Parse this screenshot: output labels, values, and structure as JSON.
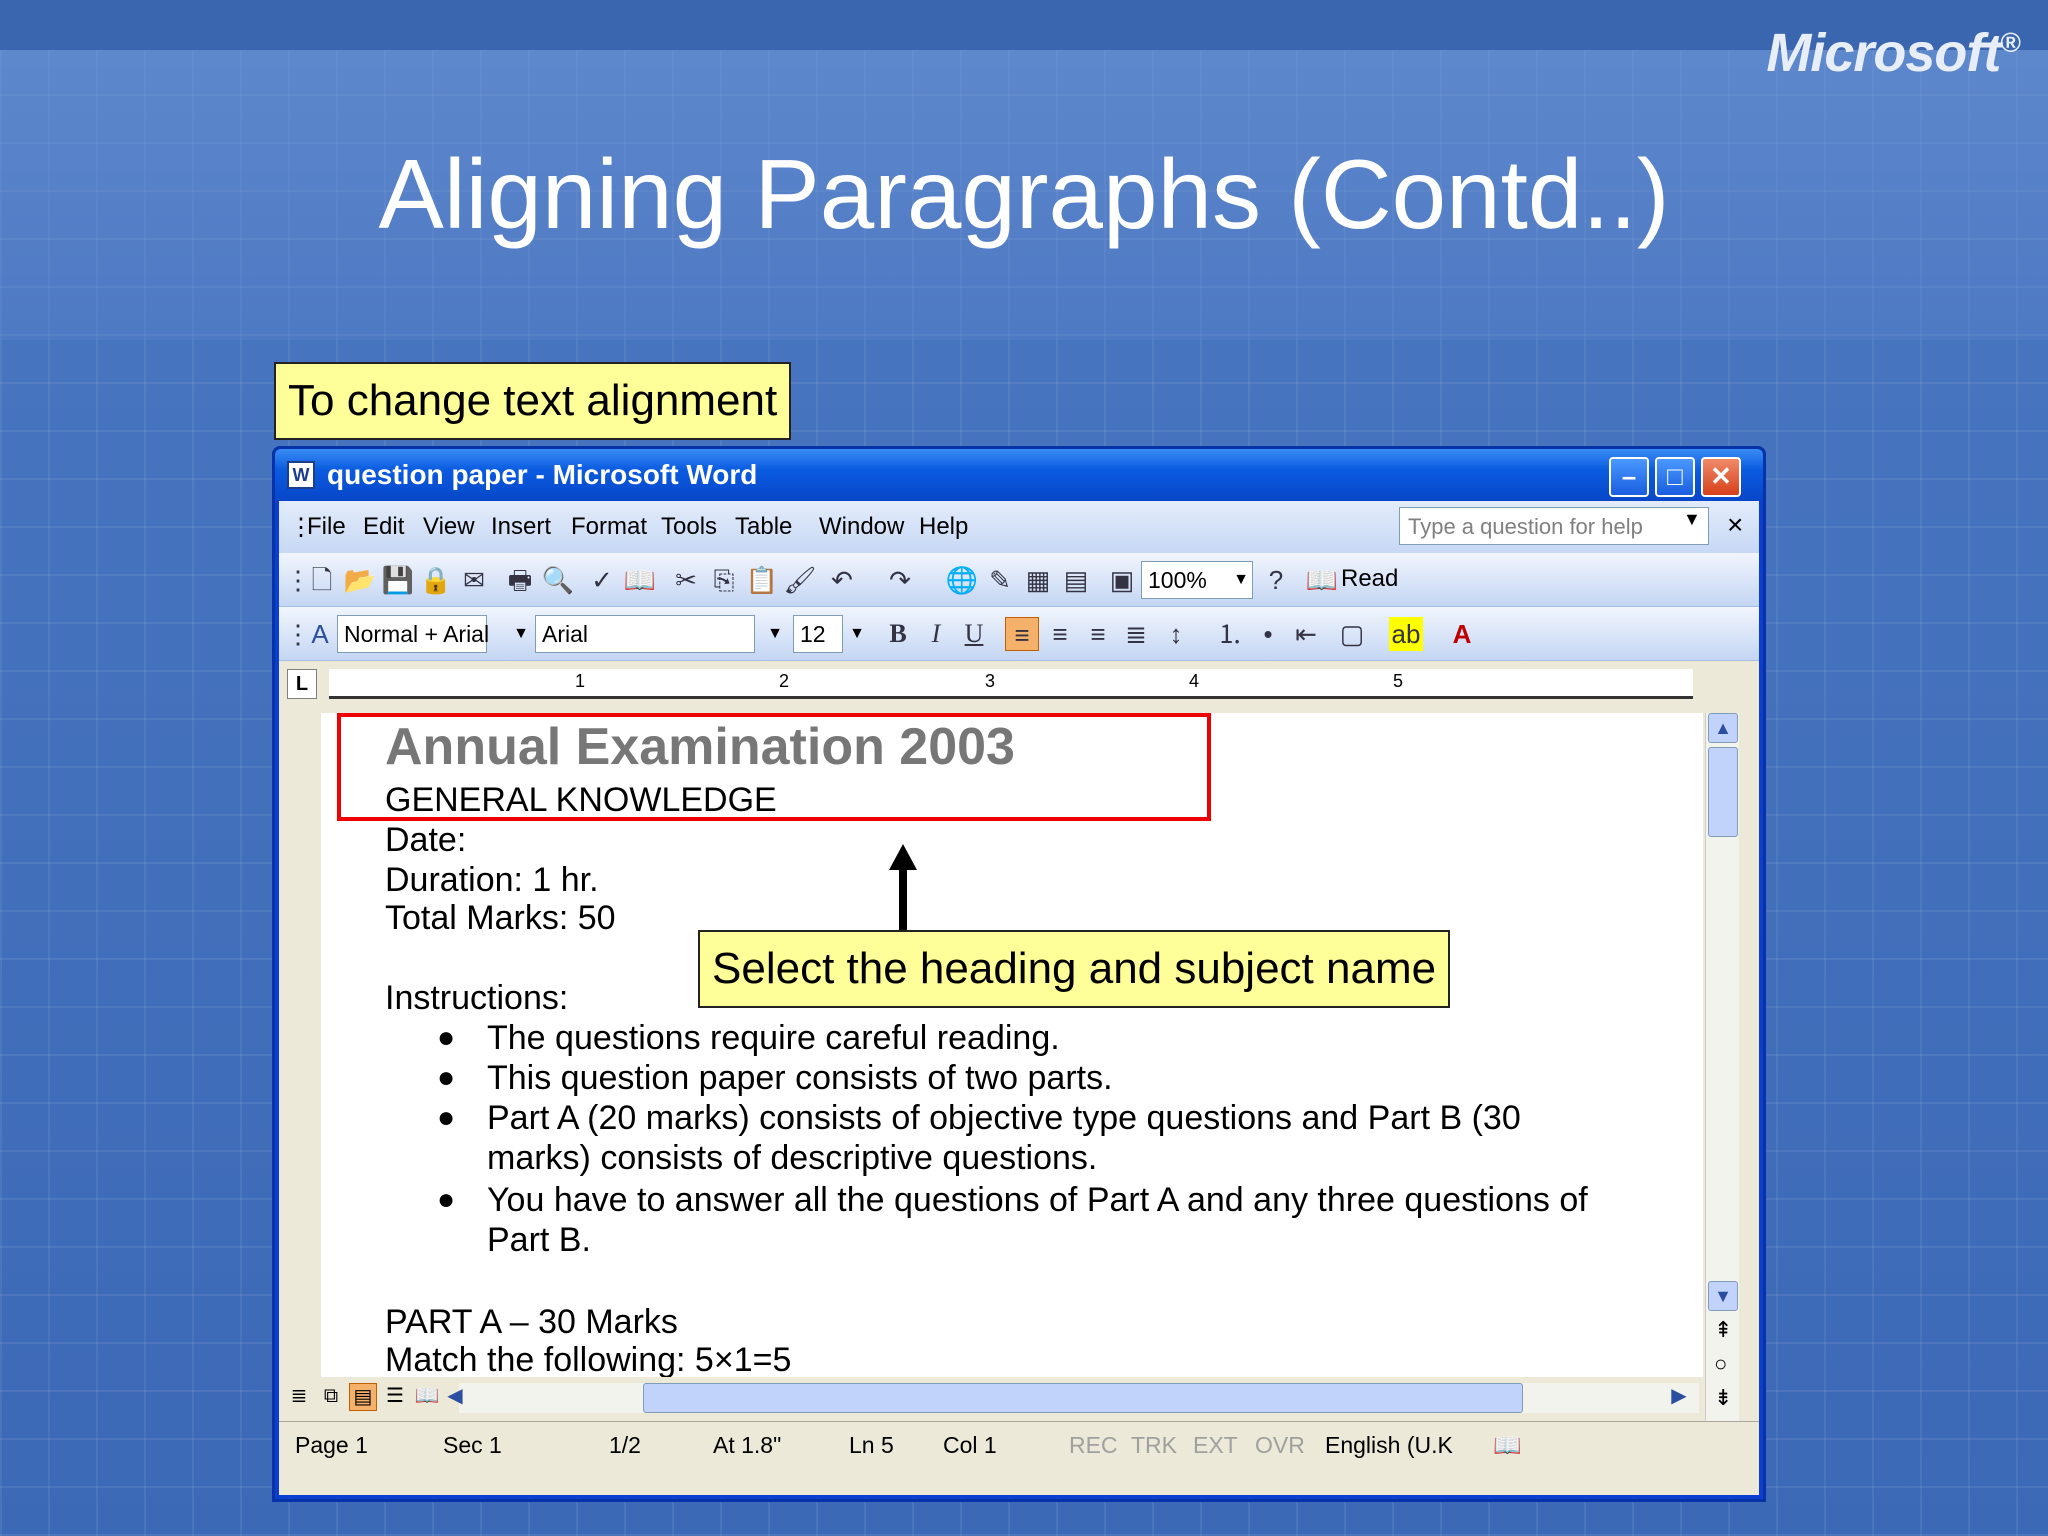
{
  "slide": {
    "brand": "Microsoft",
    "brand_mark": "®",
    "title": "Aligning Paragraphs (Contd..)",
    "callout_top": "To change text alignment",
    "callout_doc": "Select the heading and subject name"
  },
  "window": {
    "title": "question paper - Microsoft Word",
    "icon": "W"
  },
  "menu": {
    "items": [
      "File",
      "Edit",
      "View",
      "Insert",
      "Format",
      "Tools",
      "Table",
      "Window",
      "Help"
    ],
    "help_placeholder": "Type a question for help"
  },
  "standard_toolbar": {
    "zoom": "100%",
    "read_label": "Read"
  },
  "formatting_toolbar": {
    "style": "Normal + Arial",
    "font": "Arial",
    "size": "12",
    "bold": "B",
    "italic": "I",
    "underline": "U"
  },
  "ruler": {
    "numbers": [
      "1",
      "2",
      "3",
      "4",
      "5"
    ],
    "tab_selector": "L"
  },
  "document": {
    "heading": "Annual Examination 2003",
    "subject": "GENERAL KNOWLEDGE",
    "date": "Date:",
    "duration": "Duration: 1 hr.",
    "total_marks": "Total Marks: 50",
    "instructions_label": "Instructions:",
    "bullets": [
      "The questions require careful reading.",
      "This question paper consists of two parts.",
      "Part A (20 marks) consists of objective type questions and Part B (30",
      "marks) consists of descriptive questions.",
      "You have to answer all the questions of Part A and any three questions of",
      "Part B."
    ],
    "part_a": "PART A – 30 Marks",
    "match": "Match the following: 5×1=5"
  },
  "status": {
    "page": "Page 1",
    "sec": "Sec 1",
    "pages": "1/2",
    "at": "At 1.8\"",
    "ln": "Ln 5",
    "col": "Col 1",
    "rec": "REC",
    "trk": "TRK",
    "ext": "EXT",
    "ovr": "OVR",
    "language": "English (U.K"
  },
  "colors": {
    "selection": "#ee0000",
    "callout_bg": "#ffff99",
    "title_bar": "#0a5be0"
  }
}
